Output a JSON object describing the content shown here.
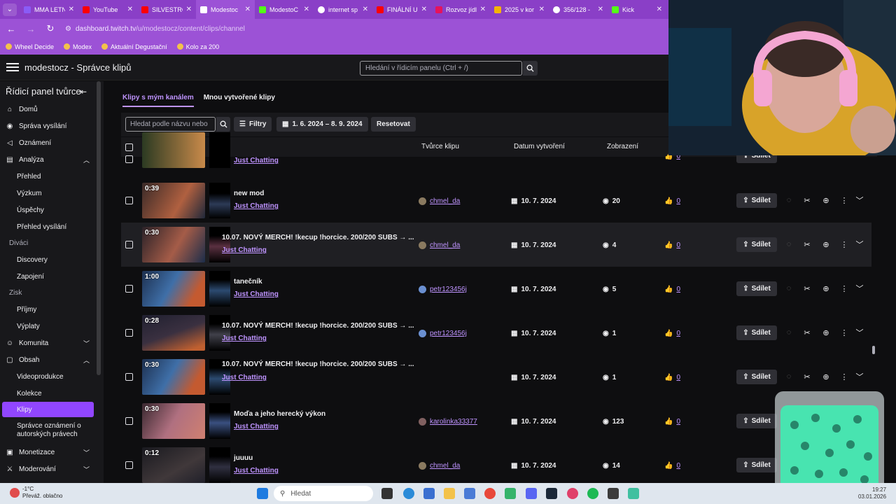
{
  "browser": {
    "tabs": [
      {
        "label": "MMA LETN",
        "color": "#8a5cf6"
      },
      {
        "label": "YouTube",
        "color": "#ff0000"
      },
      {
        "label": "SILVESTRO",
        "color": "#ff0000"
      },
      {
        "label": "Modestoc",
        "color": "#9146ff"
      },
      {
        "label": "ModestoC",
        "color": "#53fc18"
      },
      {
        "label": "internet sp",
        "color": "#ffffff"
      },
      {
        "label": "FINÁLNÍ U",
        "color": "#ff0000"
      },
      {
        "label": "Rozvoz jídl",
        "color": "#e5135c"
      },
      {
        "label": "2025 v kor",
        "color": "#f4b400"
      },
      {
        "label": "356/128 -",
        "color": "#ffffff"
      },
      {
        "label": "Kick",
        "color": "#53fc18"
      }
    ],
    "url_host": "dashboard.twitch.tv",
    "url_path": "/u/modestocz/content/clips/channel",
    "bookmarks": [
      "Wheel Decide",
      "Modex",
      "Aktuální Degustační",
      "Kolo za 200"
    ]
  },
  "topnav": {
    "title": "modestocz - Správce klipů",
    "search_placeholder": "Hledání v řídicím panelu (Ctrl + /)"
  },
  "sidebar": {
    "title": "Řídicí panel tvůrce",
    "items": [
      {
        "label": "Domů"
      },
      {
        "label": "Správa vysílání"
      },
      {
        "label": "Oznámení"
      },
      {
        "label": "Analýza"
      },
      {
        "label": "Přehled"
      },
      {
        "label": "Výzkum"
      },
      {
        "label": "Úspěchy"
      },
      {
        "label": "Přehled vysílání"
      },
      {
        "label": "Diváci"
      },
      {
        "label": "Discovery"
      },
      {
        "label": "Zapojení"
      },
      {
        "label": "Zisk"
      },
      {
        "label": "Příjmy"
      },
      {
        "label": "Výplaty"
      },
      {
        "label": "Komunita"
      },
      {
        "label": "Obsah"
      },
      {
        "label": "Videoprodukce"
      },
      {
        "label": "Kolekce"
      },
      {
        "label": "Klipy"
      },
      {
        "label": "Správce oznámení o autorských právech"
      },
      {
        "label": "Monetizace"
      },
      {
        "label": "Moderování"
      }
    ]
  },
  "content": {
    "tab_channel": "Klipy s mým kanálem",
    "tab_mine": "Mnou vytvořené klipy",
    "filter_placeholder": "Hledat podle názvu nebo",
    "filters_label": "Filtry",
    "date_range": "1. 6. 2024 – 8. 9. 2024",
    "reset_label": "Resetovat",
    "columns": {
      "creator": "Tvůrce klipu",
      "date": "Datum vytvoření",
      "views": "Zobrazení"
    },
    "share_label": "Sdílet",
    "clips": [
      {
        "duration": "",
        "title": "",
        "category": "Just Chatting",
        "creator": "",
        "date": "",
        "views": "",
        "likes": "0"
      },
      {
        "duration": "0:39",
        "title": "new mod",
        "category": "Just Chatting",
        "creator": "chmel_da",
        "date": "10. 7. 2024",
        "views": "20",
        "likes": "0"
      },
      {
        "duration": "0:30",
        "title": "10.07. NOVÝ MERCH! !kecup !horcice. 200/200 SUBS → ...",
        "category": "Just Chatting",
        "creator": "chmel_da",
        "date": "10. 7. 2024",
        "views": "4",
        "likes": "0"
      },
      {
        "duration": "1:00",
        "title": "tanečník",
        "category": "Just Chatting",
        "creator": "petr123456j",
        "date": "10. 7. 2024",
        "views": "5",
        "likes": "0"
      },
      {
        "duration": "0:28",
        "title": "10.07. NOVÝ MERCH! !kecup !horcice. 200/200 SUBS → ...",
        "category": "Just Chatting",
        "creator": "petr123456j",
        "date": "10. 7. 2024",
        "views": "1",
        "likes": "0"
      },
      {
        "duration": "0:30",
        "title": "10.07. NOVÝ MERCH! !kecup !horcice. 200/200 SUBS → ...",
        "category": "Just Chatting",
        "creator": "",
        "date": "10. 7. 2024",
        "views": "1",
        "likes": "0"
      },
      {
        "duration": "0:30",
        "title": "Moďa a jeho herecký výkon",
        "category": "Just Chatting",
        "creator": "karolinka33377",
        "date": "10. 7. 2024",
        "views": "123",
        "likes": "0"
      },
      {
        "duration": "0:12",
        "title": "juuuu",
        "category": "Just Chatting",
        "creator": "chmel_da",
        "date": "10. 7. 2024",
        "views": "14",
        "likes": "0"
      }
    ]
  },
  "taskbar": {
    "temperature": "-1°C",
    "weather": "Převáž. oblačno",
    "search_placeholder": "Hledat",
    "time": "19:27",
    "date": "03.01.2026"
  },
  "colors": {
    "accent": "#9146ff",
    "link": "#bf94ff",
    "browser": "#9c52d6"
  }
}
